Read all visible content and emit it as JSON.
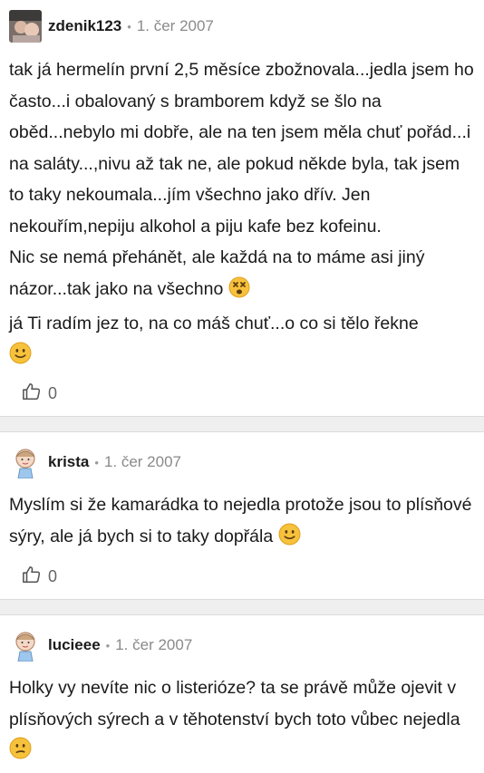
{
  "posts": [
    {
      "author": "zdenik123",
      "separator": "•",
      "date": "1. čer 2007",
      "paragraphs": [
        "tak já hermelín první 2,5 měsíce zbožnovala...jedla jsem ho často...i obalovaný s bramborem když se šlo na oběd...nebylo mi dobře, ale na ten jsem měla chuť pořád...i na saláty...,nivu až tak ne, ale pokud někde byla, tak jsem to taky nekoumala...jím všechno jako dřív. Jen nekouřím,nepiju alkohol a piju kafe bez kofeinu.",
        "Nic se nemá přehánět, ale každá na to máme asi jiný názor...tak jako na všechno",
        "já Ti radím jez to, na co máš chuť...o co si tělo řekne"
      ],
      "likes": "0"
    },
    {
      "author": "krista",
      "separator": "•",
      "date": "1. čer 2007",
      "paragraphs": [
        "Myslím si že kamarádka to nejedla protože jsou to plísňové sýry, ale já bych si to taky dopřála"
      ],
      "likes": "0"
    },
    {
      "author": "lucieee",
      "separator": "•",
      "date": "1. čer 2007",
      "paragraphs": [
        "Holky vy nevíte nic o listerióze? ta se právě může ojevit v plísňových sýrech a v těhotenství bych toto vůbec nejedla"
      ]
    }
  ],
  "icons": {
    "like": "thumbs-up-icon",
    "emoji_dizzy": "dizzy-face-emoji-icon",
    "emoji_smile": "smile-emoji-icon",
    "emoji_confused": "confused-face-emoji-icon"
  },
  "colors": {
    "author": "#1b1b1b",
    "meta": "#8a8a8a",
    "divider": "#efefef",
    "emoji": "#f6c23c"
  }
}
